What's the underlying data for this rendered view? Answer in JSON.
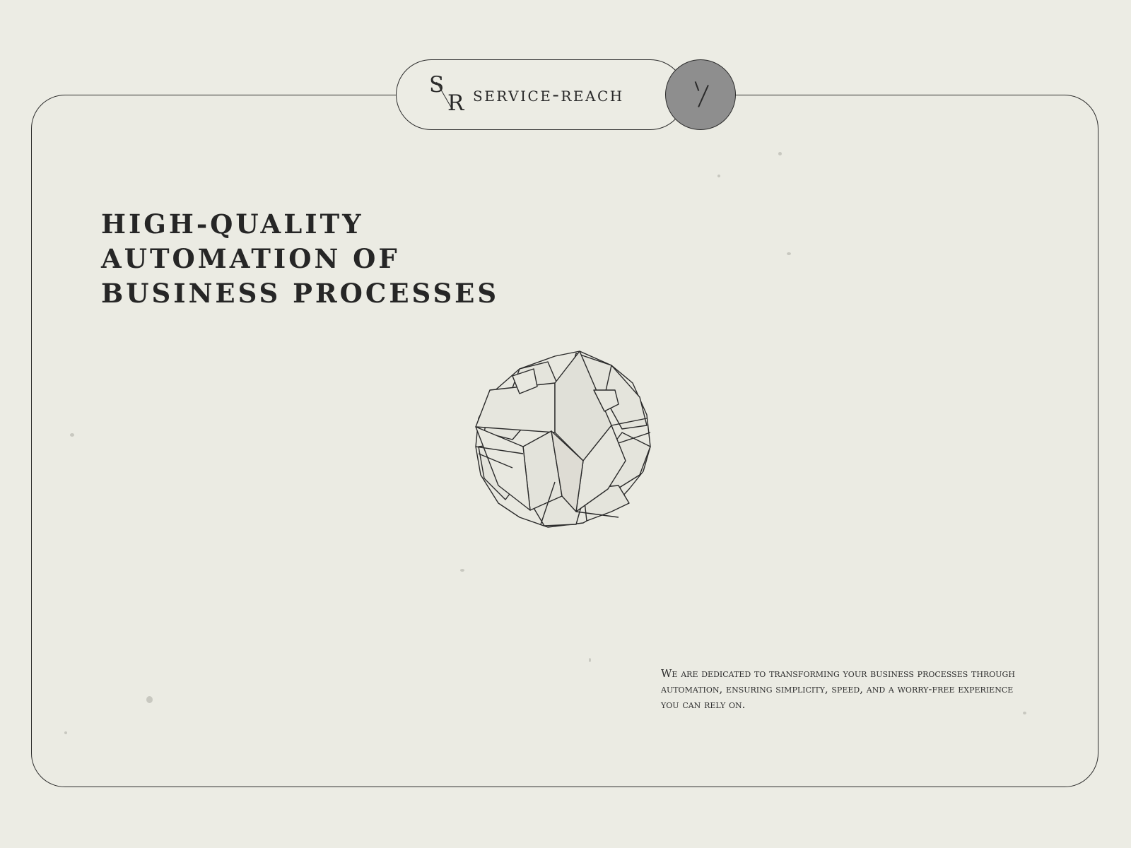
{
  "header": {
    "logo_top": "S",
    "logo_bottom": "R",
    "brand_name": "SERVICE-REACH"
  },
  "hero": {
    "headline_lines": [
      "HIGH-QUALITY",
      "AUTOMATION OF",
      "BUSINESS PROCESSES"
    ],
    "description": "We are dedicated to transforming your business processes through automation, ensuring simplicity, speed, and a worry-free experience you can rely on."
  },
  "icons": {
    "menu": "menu-slash-icon",
    "illustration": "geometric-polyhedron-illustration"
  },
  "colors": {
    "background": "#ecece4",
    "ink": "#2a2a2a",
    "menu_circle": "#8e8e8e"
  }
}
